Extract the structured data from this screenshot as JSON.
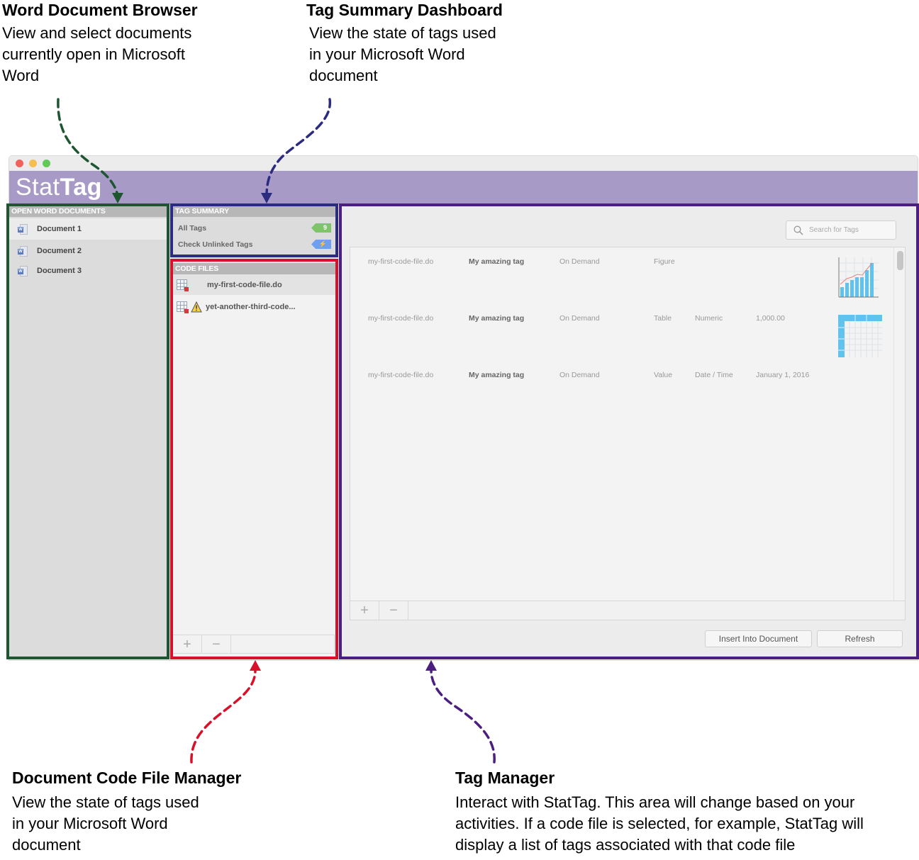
{
  "annotations": {
    "word_browser": {
      "title": "Word Document Browser",
      "desc": "View and select documents\ncurrently open in Microsoft\nWord"
    },
    "tag_summary": {
      "title": "Tag Summary Dashboard",
      "desc": "View the state of tags used\nin your Microsoft Word\ndocument"
    },
    "code_file_manager": {
      "title": "Document Code File Manager",
      "desc": "View the state of tags used\nin your Microsoft Word\ndocument"
    },
    "tag_manager": {
      "title": "Tag Manager",
      "desc": "Interact with StatTag. This area will change based on your\nactivities. If a code file is selected, for example, StatTag will\ndisplay a list of tags associated with that code file"
    }
  },
  "colors": {
    "word_browser": "#1e5632",
    "tag_summary": "#2b2b7f",
    "code_file_manager": "#d8102a",
    "tag_manager": "#4b1f7f",
    "banner": "#a89ac6"
  },
  "app": {
    "logo_light": "Stat",
    "logo_bold": "Tag"
  },
  "docs_pane": {
    "header": "OPEN WORD DOCUMENTS",
    "items": [
      "Document 1",
      "Document 2",
      "Document 3"
    ]
  },
  "tag_summary_pane": {
    "header": "TAG SUMMARY",
    "rows": [
      {
        "label": "All Tags",
        "badge": "9",
        "badge_color": "#7ec468"
      },
      {
        "label": "Check Unlinked Tags",
        "badge": "⚡",
        "badge_color": "#6f9ff0"
      }
    ]
  },
  "code_files_pane": {
    "header": "CODE FILES",
    "items": [
      {
        "name": "my-first-code-file.do",
        "warning": false
      },
      {
        "name": "yet-another-third-code...",
        "warning": true
      }
    ],
    "add": "+",
    "remove": "−"
  },
  "tag_manager": {
    "search_placeholder": "Search for Tags",
    "rows": [
      {
        "file": "my-first-code-file.do",
        "name": "My amazing tag",
        "run": "On Demand",
        "type": "Figure",
        "format": "",
        "value": "",
        "preview": "figure-chart-icon"
      },
      {
        "file": "my-first-code-file.do",
        "name": "My amazing tag",
        "run": "On Demand",
        "type": "Table",
        "format": "Numeric",
        "value": "1,000.00",
        "preview": "table-grid-icon"
      },
      {
        "file": "my-first-code-file.do",
        "name": "My amazing tag",
        "run": "On Demand",
        "type": "Value",
        "format": "Date / Time",
        "value": "January 1, 2016",
        "preview": ""
      }
    ],
    "add": "+",
    "remove": "−",
    "insert_button": "Insert Into Document",
    "refresh_button": "Refresh"
  }
}
